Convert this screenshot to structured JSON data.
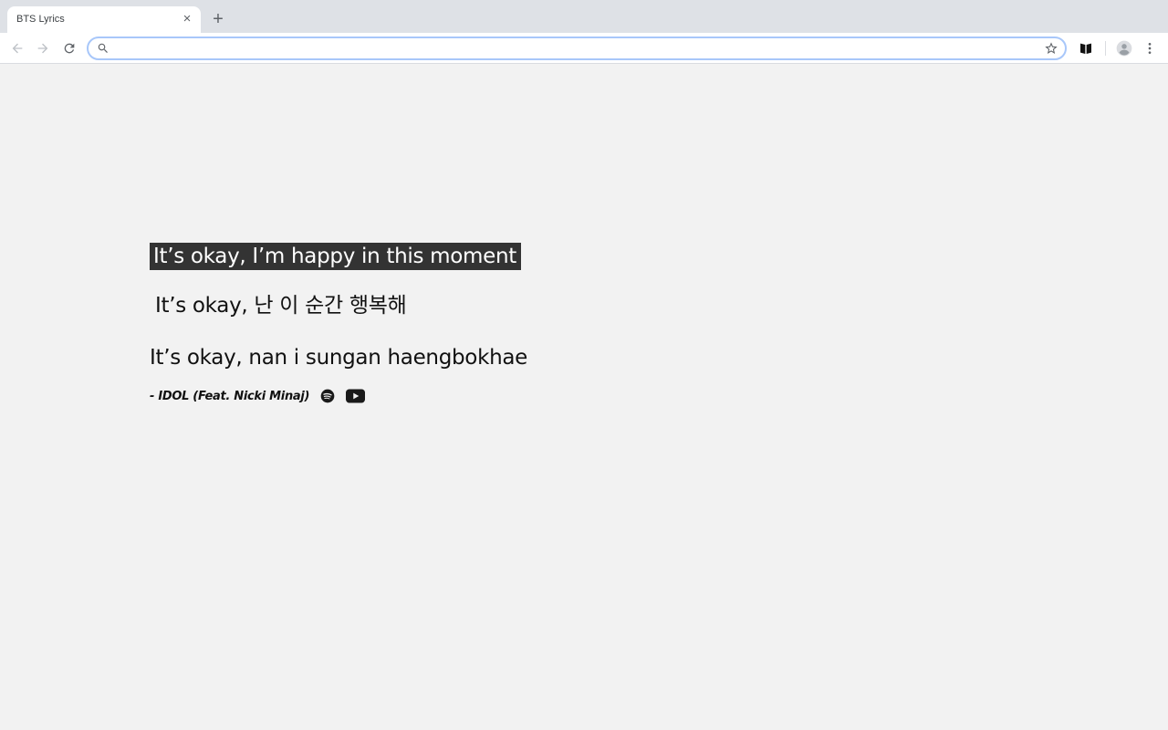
{
  "browser": {
    "tab": {
      "title": "BTS Lyrics",
      "close_symbol": "×"
    },
    "new_tab_symbol": "+",
    "toolbar": {
      "back_icon": "arrow-back-icon",
      "forward_icon": "arrow-forward-icon",
      "reload_icon": "reload-icon",
      "omnibox": {
        "value": "",
        "placeholder": ""
      },
      "bookmark_icon": "star-icon",
      "extension_icon": "extension-book-icon",
      "profile_icon": "avatar-icon",
      "menu_icon": "kebab-menu-icon"
    },
    "colors": {
      "tabstrip": "#dee1e6",
      "omnibox_focus": "#a8c7fa"
    }
  },
  "page": {
    "lyric_english": "It’s okay, I’m happy in this moment",
    "lyric_korean": "It’s okay, 난 이 순간 행복해",
    "lyric_romanized": "It’s okay, nan i sungan haengbokhae",
    "source": "- IDOL (Feat. Nicki Minaj)",
    "links": {
      "spotify_icon": "spotify-icon",
      "youtube_icon": "youtube-icon"
    },
    "colors": {
      "background": "#f2f2f2",
      "highlight_bg": "#333333",
      "highlight_text": "#ffffff",
      "text": "#111111"
    }
  }
}
